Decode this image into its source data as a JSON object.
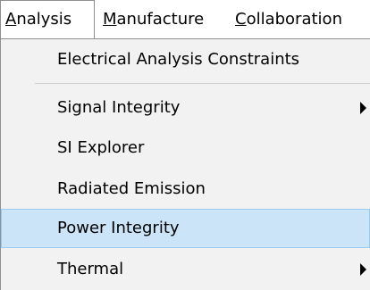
{
  "menubar": {
    "items": [
      {
        "mnemonic": "A",
        "rest": "nalysis"
      },
      {
        "mnemonic": "M",
        "rest": "anufacture"
      },
      {
        "mnemonic": "C",
        "rest": "ollaboration"
      }
    ]
  },
  "dropdown": {
    "items": [
      {
        "label": "Electrical Analysis Constraints"
      },
      {
        "label": "Signal Integrity",
        "submenu_icon": "chevron-right-icon"
      },
      {
        "label": "SI Explorer"
      },
      {
        "label": "Radiated Emission"
      },
      {
        "label": "Power Integrity",
        "highlighted": true
      },
      {
        "label": "Thermal",
        "submenu_icon": "chevron-right-icon"
      }
    ]
  },
  "colors": {
    "highlight_bg": "#cce4f7",
    "highlight_border": "#99c9ef",
    "menu_bg": "#f2f2f2",
    "border": "#8f8f8f"
  }
}
